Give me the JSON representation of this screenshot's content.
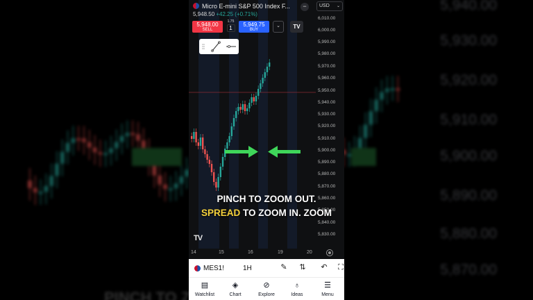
{
  "header": {
    "symbol_title": "Micro E-mini S&P 500 Index F...",
    "last_price": "5,948.50",
    "change": "+42.25 (+0.71%)",
    "currency": "USD"
  },
  "trade": {
    "sell_price": "5,948.00",
    "sell_label": "SELL",
    "buy_price": "5,949.75",
    "buy_label": "BUY",
    "spread": "1.75",
    "quantity": "1"
  },
  "price_axis": [
    "6,010.00",
    "6,000.00",
    "5,990.00",
    "5,980.00",
    "5,970.00",
    "5,960.00",
    "5,950.00",
    "5,940.00",
    "5,930.00",
    "5,920.00",
    "5,910.00",
    "5,900.00",
    "5,890.00",
    "5,880.00",
    "5,870.00",
    "5,860.00",
    "5,850.00",
    "5,840.00",
    "5,830.00"
  ],
  "time_axis": [
    "14",
    "15",
    "16",
    "19",
    "20"
  ],
  "caption": {
    "line1": "PINCH TO ZOOM OUT.",
    "line2_highlight": "SPREAD",
    "line2_rest": " TO ZOOM IN. ZOOM"
  },
  "toolbar": {
    "symbol": "MES1!",
    "interval": "1H"
  },
  "nav": [
    {
      "label": "Watchlist",
      "icon": "watchlist-icon"
    },
    {
      "label": "Chart",
      "icon": "chart-icon"
    },
    {
      "label": "Explore",
      "icon": "explore-icon"
    },
    {
      "label": "Ideas",
      "icon": "ideas-icon"
    },
    {
      "label": "Menu",
      "icon": "menu-icon"
    }
  ],
  "background": {
    "prices": [
      "5,940.00",
      "5,930.00",
      "5,920.00",
      "5,910.00",
      "5,900.00",
      "5,890.00",
      "5,880.00",
      "5,870.00"
    ],
    "bottom_text": "PINCH TO ZOOM OUT"
  },
  "colors": {
    "up": "#26a69a",
    "down": "#ef5350",
    "arrow": "#3fd65a",
    "highlight": "#f6d23c"
  }
}
